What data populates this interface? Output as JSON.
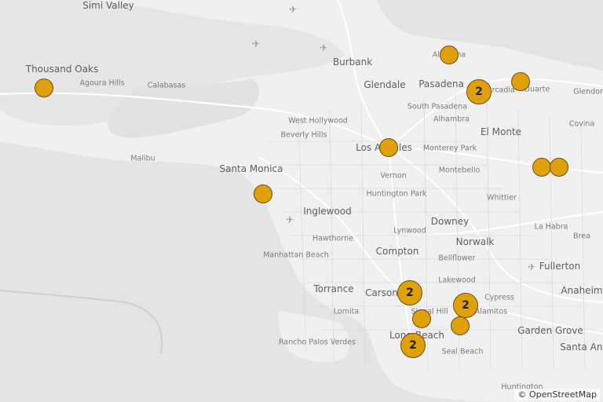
{
  "map": {
    "attribution_symbol": "©",
    "attribution_link": "OpenStreetMap",
    "colors": {
      "water": "#e6e6e6",
      "land": "#f1f1f1",
      "road": "#ffffff",
      "marker_fill": "#e0a00a",
      "marker_stroke": "#6b4e12"
    },
    "labels": [
      {
        "id": "simi-valley",
        "text": "Simi Valley",
        "kind": "city"
      },
      {
        "id": "thousand-oaks",
        "text": "Thousand Oaks",
        "kind": "city"
      },
      {
        "id": "agoura-hills",
        "text": "Agoura Hills",
        "kind": "town"
      },
      {
        "id": "calabasas",
        "text": "Calabasas",
        "kind": "town"
      },
      {
        "id": "malibu",
        "text": "Malibu",
        "kind": "town"
      },
      {
        "id": "burbank",
        "text": "Burbank",
        "kind": "city"
      },
      {
        "id": "glendale",
        "text": "Glendale",
        "kind": "city"
      },
      {
        "id": "pasadena",
        "text": "Pasadena",
        "kind": "city"
      },
      {
        "id": "altadena",
        "text": "Altadena",
        "kind": "town"
      },
      {
        "id": "arcadia",
        "text": "Arcadia",
        "kind": "town"
      },
      {
        "id": "duarte",
        "text": "Duarte",
        "kind": "town"
      },
      {
        "id": "glendora",
        "text": "Glendora",
        "kind": "town"
      },
      {
        "id": "south-pasadena",
        "text": "South Pasadena",
        "kind": "town"
      },
      {
        "id": "alhambra",
        "text": "Alhambra",
        "kind": "town"
      },
      {
        "id": "el-monte",
        "text": "El Monte",
        "kind": "city"
      },
      {
        "id": "covina",
        "text": "Covina",
        "kind": "town"
      },
      {
        "id": "west-hollywood",
        "text": "West Hollywood",
        "kind": "town"
      },
      {
        "id": "beverly-hills",
        "text": "Beverly Hills",
        "kind": "town"
      },
      {
        "id": "los-angeles",
        "text": "Los Angeles",
        "kind": "city"
      },
      {
        "id": "monterey-park",
        "text": "Monterey Park",
        "kind": "town"
      },
      {
        "id": "santa-monica",
        "text": "Santa Monica",
        "kind": "city"
      },
      {
        "id": "vernon",
        "text": "Vernon",
        "kind": "town"
      },
      {
        "id": "montebello",
        "text": "Montebello",
        "kind": "town"
      },
      {
        "id": "huntington-park",
        "text": "Huntington Park",
        "kind": "town"
      },
      {
        "id": "whittier",
        "text": "Whittier",
        "kind": "town"
      },
      {
        "id": "inglewood",
        "text": "Inglewood",
        "kind": "city"
      },
      {
        "id": "downey",
        "text": "Downey",
        "kind": "city"
      },
      {
        "id": "hawthorne",
        "text": "Hawthorne",
        "kind": "town"
      },
      {
        "id": "la-habra",
        "text": "La Habra",
        "kind": "town"
      },
      {
        "id": "brea",
        "text": "Brea",
        "kind": "town"
      },
      {
        "id": "lynwood",
        "text": "Lynwood",
        "kind": "town"
      },
      {
        "id": "norwalk",
        "text": "Norwalk",
        "kind": "city"
      },
      {
        "id": "manhattan-beach",
        "text": "Manhattan Beach",
        "kind": "town"
      },
      {
        "id": "compton",
        "text": "Compton",
        "kind": "city"
      },
      {
        "id": "bellflower",
        "text": "Bellflower",
        "kind": "town"
      },
      {
        "id": "fullerton",
        "text": "Fullerton",
        "kind": "city"
      },
      {
        "id": "lakewood",
        "text": "Lakewood",
        "kind": "town"
      },
      {
        "id": "torrance",
        "text": "Torrance",
        "kind": "city"
      },
      {
        "id": "carson",
        "text": "Carson",
        "kind": "city"
      },
      {
        "id": "cypress",
        "text": "Cypress",
        "kind": "town"
      },
      {
        "id": "anaheim",
        "text": "Anaheim",
        "kind": "city"
      },
      {
        "id": "lomita",
        "text": "Lomita",
        "kind": "town"
      },
      {
        "id": "signal-hill",
        "text": "Signal Hill",
        "kind": "town"
      },
      {
        "id": "los-alamitos",
        "text": "Los Alamitos",
        "kind": "town"
      },
      {
        "id": "garden-grove",
        "text": "Garden Grove",
        "kind": "city"
      },
      {
        "id": "long-beach",
        "text": "Long Beach",
        "kind": "city"
      },
      {
        "id": "rancho-palos-verdes",
        "text": "Rancho Palos Verdes",
        "kind": "town"
      },
      {
        "id": "seal-beach",
        "text": "Seal Beach",
        "kind": "town"
      },
      {
        "id": "santa-ana",
        "text": "Santa Ana",
        "kind": "city"
      },
      {
        "id": "huntington",
        "text": "Huntington",
        "kind": "town"
      }
    ],
    "markers": [
      {
        "id": "thousand-oaks",
        "count": ""
      },
      {
        "id": "altadena",
        "count": ""
      },
      {
        "id": "duarte",
        "count": ""
      },
      {
        "id": "arcadia",
        "count": "2"
      },
      {
        "id": "los-angeles",
        "count": ""
      },
      {
        "id": "santa-monica",
        "count": ""
      },
      {
        "id": "east-1",
        "count": ""
      },
      {
        "id": "east-2",
        "count": ""
      },
      {
        "id": "carson",
        "count": "2"
      },
      {
        "id": "los-alamitos",
        "count": "2"
      },
      {
        "id": "signal-hill",
        "count": ""
      },
      {
        "id": "seal-beach",
        "count": ""
      },
      {
        "id": "long-beach",
        "count": "2"
      }
    ]
  }
}
